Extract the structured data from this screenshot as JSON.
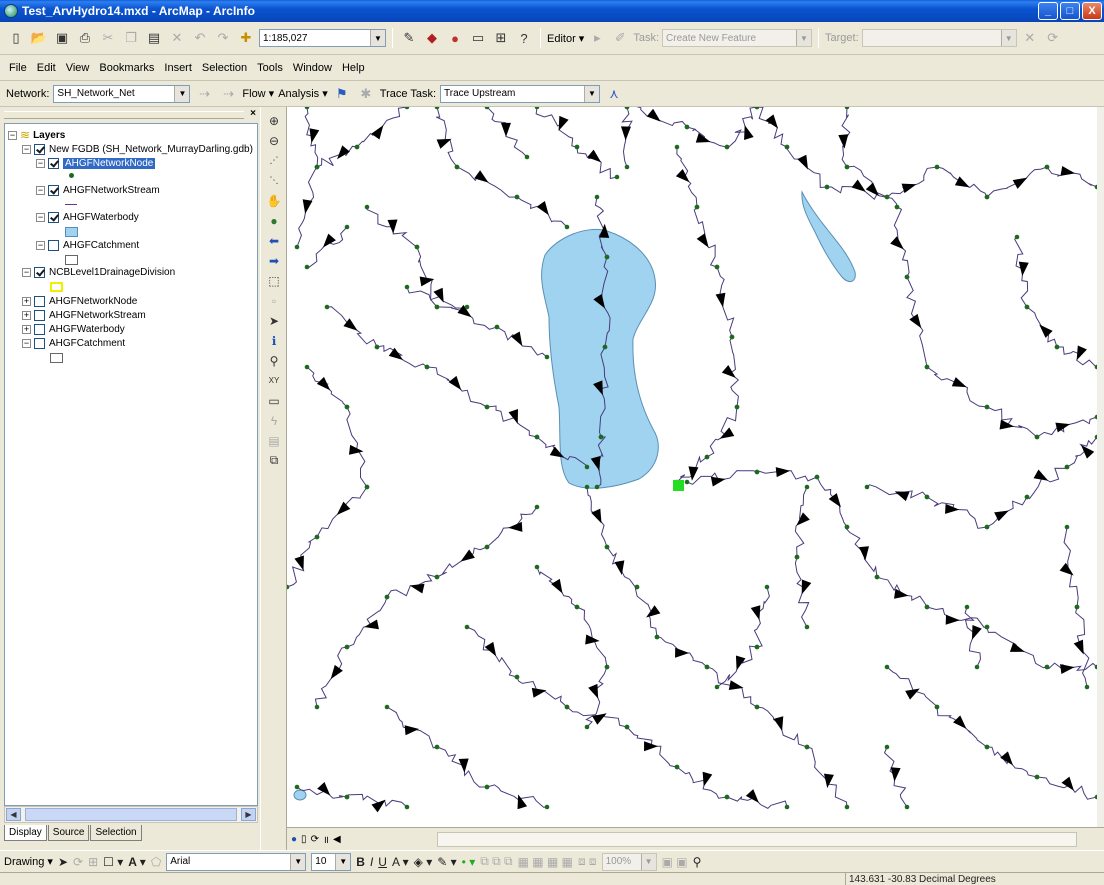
{
  "window": {
    "title": "Test_ArvHydro14.mxd - ArcMap - ArcInfo",
    "buttons": [
      "_",
      "□",
      "X"
    ]
  },
  "toolbar": {
    "scale": "1:185,027",
    "editor_label": "Editor ▾",
    "task_label": "Task:",
    "task_value": "Create New Feature",
    "target_label": "Target:",
    "target_value": ""
  },
  "menu": {
    "items": [
      "File",
      "Edit",
      "View",
      "Bookmarks",
      "Insert",
      "Selection",
      "Tools",
      "Window",
      "Help"
    ]
  },
  "network": {
    "label": "Network:",
    "value": "SH_Network_Net",
    "flow_label": "Flow ▾",
    "analysis_label": "Analysis ▾",
    "trace_task_label": "Trace Task:",
    "trace_task_value": "Trace Upstream"
  },
  "toc": {
    "root": "Layers",
    "items": [
      {
        "label": "New FGDB (SH_Network_MurrayDarling.gdb)",
        "checked": true
      },
      {
        "label": "AHGFNetworkNode",
        "checked": true
      },
      {
        "label": "AHGFNetworkStream",
        "checked": true
      },
      {
        "label": "AHGFWaterbody",
        "checked": true
      },
      {
        "label": "AHGFCatchment",
        "checked": false
      },
      {
        "label": "NCBLevel1DrainageDivision",
        "checked": true
      },
      {
        "label": "AHGFNetworkNode",
        "checked": false
      },
      {
        "label": "AHGFNetworkStream",
        "checked": false
      },
      {
        "label": "AHGFWaterbody",
        "checked": false
      },
      {
        "label": "AHGFCatchment",
        "checked": false
      }
    ],
    "tabs": [
      "Display",
      "Source",
      "Selection"
    ]
  },
  "drawing": {
    "drawing_label": "Drawing ▾",
    "font_name": "Arial",
    "font_size": "10",
    "zoom": "100%"
  },
  "status": {
    "coordinates": "143.631  -30.83 Decimal Degrees"
  },
  "colors": {
    "water": "#9fd3f0",
    "stream": "#4a3a7c",
    "node": "#1d6a1d",
    "flag": "#22dd22"
  }
}
